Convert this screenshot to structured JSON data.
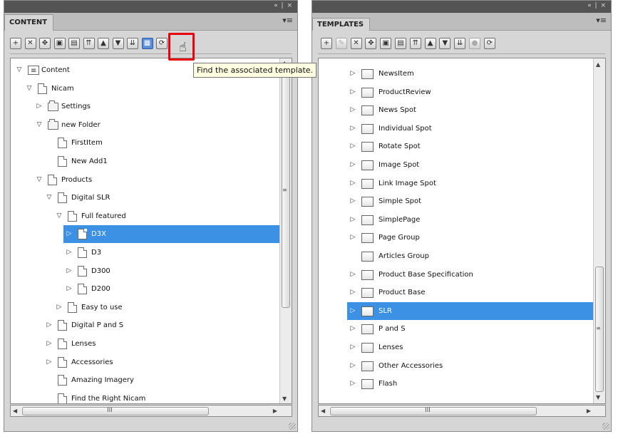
{
  "panel_controls": "«  |  ×",
  "panel_menu_glyph": "▾≡",
  "content_panel": {
    "tab_label": "CONTENT",
    "toolbar": [
      {
        "icon": "add-icon",
        "glyph": "+"
      },
      {
        "icon": "delete-icon",
        "glyph": "✕"
      },
      {
        "icon": "move-icon",
        "glyph": "✥"
      },
      {
        "icon": "copy-icon",
        "glyph": "▣"
      },
      {
        "icon": "paste-icon",
        "glyph": "▤"
      },
      {
        "icon": "move-top-icon",
        "glyph": "⇈"
      },
      {
        "icon": "move-up-icon",
        "glyph": "▲"
      },
      {
        "icon": "move-down-icon",
        "glyph": "▼"
      },
      {
        "icon": "move-bottom-icon",
        "glyph": "⇊"
      },
      {
        "icon": "find-template-icon",
        "glyph": "▦"
      },
      {
        "icon": "refresh-icon",
        "glyph": "⟳"
      }
    ],
    "tooltip": "Find the associated template.",
    "tree": [
      {
        "label": "Content",
        "level": 0,
        "expander": "expanded",
        "icon": "root"
      },
      {
        "label": "Nicam",
        "level": 1,
        "expander": "expanded",
        "icon": "page"
      },
      {
        "label": "Settings",
        "level": 2,
        "expander": "collapsed",
        "icon": "folder"
      },
      {
        "label": "new Folder",
        "level": 2,
        "expander": "expanded",
        "icon": "folder"
      },
      {
        "label": "FirstItem",
        "level": 3,
        "expander": "none",
        "icon": "page"
      },
      {
        "label": "New Add1",
        "level": 3,
        "expander": "none",
        "icon": "page"
      },
      {
        "label": "Products",
        "level": 2,
        "expander": "expanded",
        "icon": "page"
      },
      {
        "label": "Digital SLR",
        "level": 3,
        "expander": "expanded",
        "icon": "page"
      },
      {
        "label": "Full featured",
        "level": 4,
        "expander": "expanded",
        "icon": "page"
      },
      {
        "label": "D3X",
        "level": 5,
        "expander": "collapsed",
        "icon": "page",
        "selected": true
      },
      {
        "label": "D3",
        "level": 5,
        "expander": "collapsed",
        "icon": "page"
      },
      {
        "label": "D300",
        "level": 5,
        "expander": "collapsed",
        "icon": "page"
      },
      {
        "label": "D200",
        "level": 5,
        "expander": "collapsed",
        "icon": "page"
      },
      {
        "label": "Easy to use",
        "level": 4,
        "expander": "collapsed",
        "icon": "page"
      },
      {
        "label": "Digital P and S",
        "level": 3,
        "expander": "collapsed",
        "icon": "page"
      },
      {
        "label": "Lenses",
        "level": 3,
        "expander": "collapsed",
        "icon": "page"
      },
      {
        "label": "Accessories",
        "level": 3,
        "expander": "collapsed",
        "icon": "page"
      },
      {
        "label": "Amazing Imagery",
        "level": 3,
        "expander": "none",
        "icon": "page"
      },
      {
        "label": "Find the Right Nicam",
        "level": 3,
        "expander": "none",
        "icon": "page"
      }
    ],
    "hscroll_grip": "III"
  },
  "templates_panel": {
    "tab_label": "TEMPLATES",
    "toolbar": [
      {
        "icon": "add-icon",
        "glyph": "+"
      },
      {
        "icon": "edit-icon",
        "glyph": "✎",
        "disabled": true
      },
      {
        "icon": "delete-icon",
        "glyph": "✕"
      },
      {
        "icon": "move-icon",
        "glyph": "✥"
      },
      {
        "icon": "copy-icon",
        "glyph": "▣"
      },
      {
        "icon": "paste-icon",
        "glyph": "▤"
      },
      {
        "icon": "move-top-icon",
        "glyph": "⇈"
      },
      {
        "icon": "move-up-icon",
        "glyph": "▲"
      },
      {
        "icon": "move-down-icon",
        "glyph": "▼"
      },
      {
        "icon": "move-bottom-icon",
        "glyph": "⇊"
      },
      {
        "icon": "stop-icon",
        "glyph": "●",
        "disabled": true
      },
      {
        "icon": "refresh-icon",
        "glyph": "⟳"
      }
    ],
    "tree": [
      {
        "label": "NewsItem",
        "expander": "collapsed"
      },
      {
        "label": "ProductReview",
        "expander": "collapsed"
      },
      {
        "label": "News Spot",
        "expander": "collapsed"
      },
      {
        "label": "Individual Spot",
        "expander": "collapsed"
      },
      {
        "label": "Rotate Spot",
        "expander": "collapsed"
      },
      {
        "label": "Image Spot",
        "expander": "collapsed"
      },
      {
        "label": "Link Image Spot",
        "expander": "collapsed"
      },
      {
        "label": "Simple Spot",
        "expander": "collapsed"
      },
      {
        "label": "SimplePage",
        "expander": "collapsed"
      },
      {
        "label": "Page Group",
        "expander": "collapsed"
      },
      {
        "label": "Articles Group",
        "expander": "none"
      },
      {
        "label": "Product Base Specification",
        "expander": "collapsed"
      },
      {
        "label": "Product Base",
        "expander": "collapsed"
      },
      {
        "label": "SLR",
        "expander": "collapsed",
        "selected": true
      },
      {
        "label": "P and S",
        "expander": "collapsed"
      },
      {
        "label": "Lenses",
        "expander": "collapsed"
      },
      {
        "label": "Other Accessories",
        "expander": "collapsed"
      },
      {
        "label": "Flash",
        "expander": "collapsed"
      }
    ],
    "hscroll_grip": "III"
  },
  "colors": {
    "selection": "#3c91e4",
    "highlight_box": "#e8000e",
    "tooltip_bg": "#ffffe1"
  }
}
